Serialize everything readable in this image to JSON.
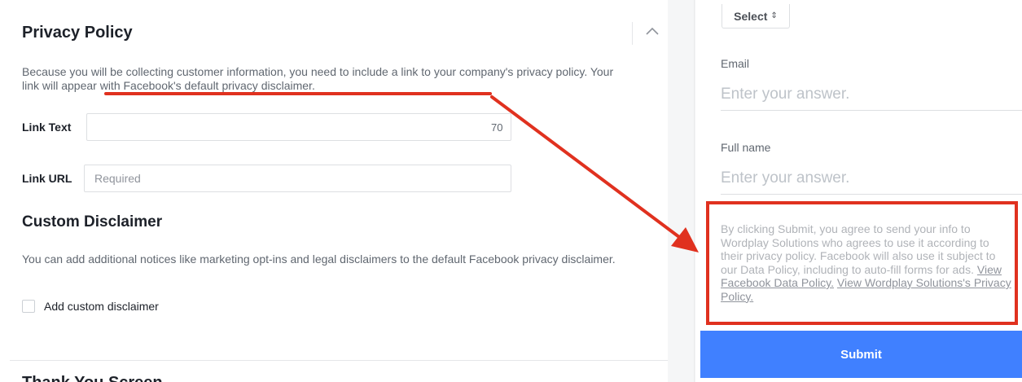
{
  "privacy_policy": {
    "title": "Privacy Policy",
    "description_plain": "Because you will be collecting customer information, you need to include a link to your company's privacy policy.",
    "description_highlight": "Your link will appear with Facebook's default privacy disclaimer.",
    "link_text_label": "Link Text",
    "link_text_value": "",
    "link_text_char_count": "70",
    "link_url_label": "Link URL",
    "link_url_placeholder": "Required",
    "collapse_icon": "chevron-up-icon"
  },
  "custom_disclaimer": {
    "title": "Custom Disclaimer",
    "description": "You can add additional notices like marketing opt-ins and legal disclaimers to the default Facebook privacy disclaimer.",
    "checkbox_label": "Add custom disclaimer",
    "checked": false
  },
  "next_section": {
    "title": "Thank You Screen"
  },
  "preview": {
    "select_label": "Select",
    "select_icon": "sort-caret-icon",
    "questions": [
      {
        "label": "Email",
        "placeholder": "Enter your answer."
      },
      {
        "label": "Full name",
        "placeholder": "Enter your answer."
      }
    ],
    "disclaimer_text": "By clicking Submit, you agree to send your info to Wordplay Solutions who agrees to use it according to their privacy policy. Facebook will also use it subject to our Data Policy, including to auto-fill forms for ads.",
    "link_data_policy": "View Facebook Data Policy.",
    "link_privacy_policy": "View Wordplay Solutions's Privacy Policy.",
    "submit_label": "Submit"
  },
  "colors": {
    "annotation_red": "#e0311f",
    "submit_blue": "#4080ff",
    "panel_gap": "#f5f6f7"
  }
}
